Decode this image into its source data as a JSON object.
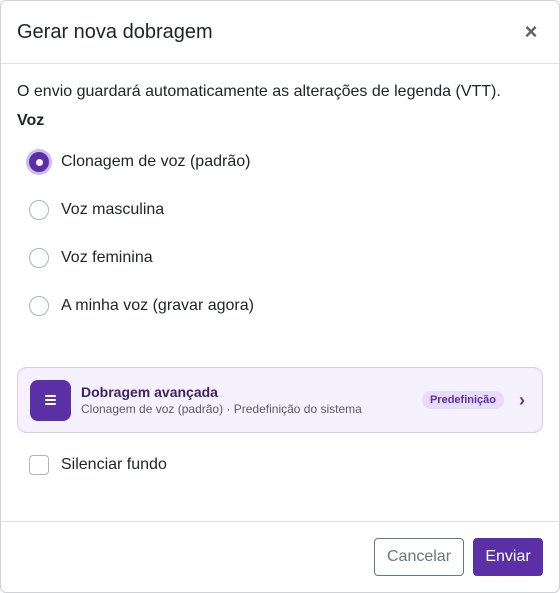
{
  "header": {
    "title": "Gerar nova dobragem",
    "close_symbol": "×"
  },
  "info_text": "O envio guardará automaticamente as alterações de legenda (VTT).",
  "voice_section": {
    "label": "Voz",
    "options": [
      {
        "label": "Clonagem de voz (padrão)",
        "checked": true
      },
      {
        "label": "Voz masculina",
        "checked": false
      },
      {
        "label": "Voz feminina",
        "checked": false
      },
      {
        "label": "A minha voz (gravar agora)",
        "checked": false
      }
    ]
  },
  "advanced": {
    "title": "Dobragem avançada",
    "subtitle": "Clonagem de voz (padrão) · Predefinição do sistema",
    "badge": "Predefinição",
    "icon": "list-icon",
    "chevron": "›"
  },
  "mute_background": {
    "label": "Silenciar fundo",
    "checked": false
  },
  "footer": {
    "cancel_label": "Cancelar",
    "send_label": "Enviar"
  },
  "colors": {
    "accent": "#5b30a6",
    "card_bg": "#f5f1fe",
    "badge_bg": "#e7dcfb"
  }
}
